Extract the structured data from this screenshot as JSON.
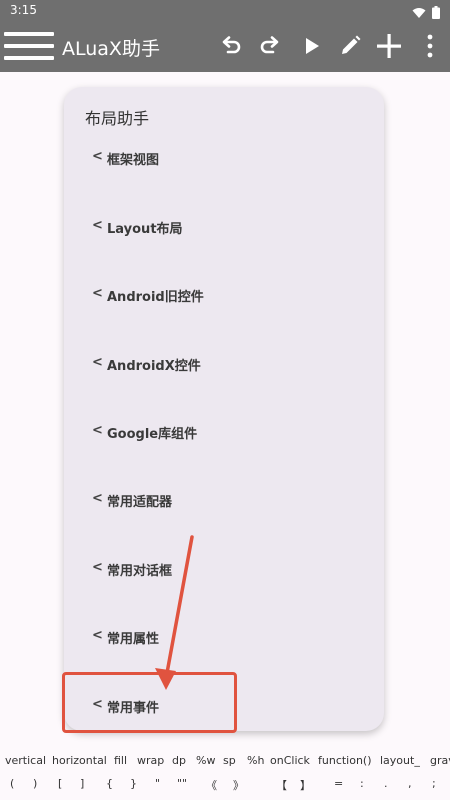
{
  "status_bar": {
    "time": "3:15"
  },
  "toolbar": {
    "title": "ALuaX助手"
  },
  "dialog": {
    "title": "布局助手",
    "chevron": "<",
    "items": [
      {
        "label": "框架视图"
      },
      {
        "label": "Layout布局"
      },
      {
        "label": "Android旧控件"
      },
      {
        "label": "AndroidX控件"
      },
      {
        "label": "Google库组件"
      },
      {
        "label": "常用适配器"
      },
      {
        "label": "常用对话框"
      },
      {
        "label": "常用属性"
      },
      {
        "label": "常用事件"
      }
    ]
  },
  "keyword_bar": [
    "vertical",
    "horizontal",
    "fill",
    "wrap",
    "dp",
    "%w",
    "sp",
    "%h",
    "onClick",
    "function()",
    "layout_",
    "grav"
  ],
  "symbol_bar": [
    "(",
    ")",
    "[",
    "]",
    "{",
    "}",
    "\"",
    "\"\"",
    "《",
    "》",
    "【",
    "】",
    "=",
    ":",
    ".",
    ",",
    ";"
  ],
  "colors": {
    "toolbar": "#6f6f6f",
    "dialog": "#ede8f0",
    "annotation": "#e0533f"
  }
}
